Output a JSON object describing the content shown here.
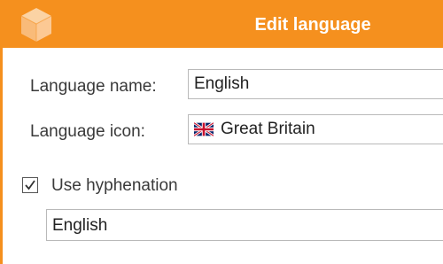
{
  "dialog": {
    "title": "Edit language",
    "app_icon": "cube-icon"
  },
  "form": {
    "language_name_label": "Language name:",
    "language_name_value": "English",
    "language_icon_label": "Language icon:",
    "language_icon_value": "Great Britain",
    "language_icon_flag": "flag-gb-icon",
    "hyphenation_label": "Use hyphenation",
    "hyphenation_checked": true,
    "hyphenation_language": "English"
  },
  "colors": {
    "accent": "#f5901e"
  }
}
